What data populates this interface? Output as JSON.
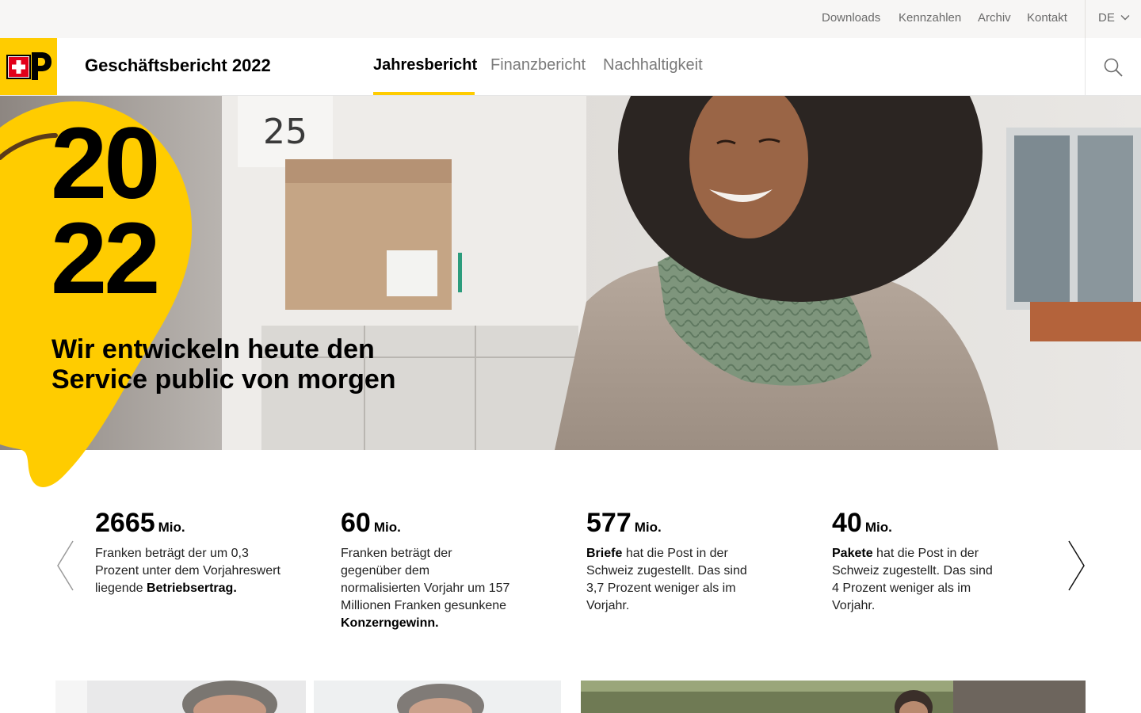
{
  "utility_nav": {
    "links": [
      "Downloads",
      "Kennzahlen",
      "Archiv",
      "Kontakt"
    ],
    "language": "DE"
  },
  "header": {
    "title": "Geschäftsbericht 2022",
    "nav": [
      {
        "label": "Jahresbericht",
        "active": true
      },
      {
        "label": "Finanzbericht",
        "active": false
      },
      {
        "label": "Nachhaltigkeit",
        "active": false
      }
    ]
  },
  "colors": {
    "brand_yellow": "#ffcc00",
    "logo_red": "#e2001a"
  },
  "icons": [
    "swiss-post-logo",
    "chevron-down-icon",
    "search-icon",
    "chevron-left-icon",
    "chevron-right-icon"
  ],
  "hero": {
    "year_top": "20",
    "year_bottom": "22",
    "headline_line1": "Wir entwickeln heute den",
    "headline_line2": "Service public von morgen",
    "house_number": "25"
  },
  "key_figures": [
    {
      "value": "2665",
      "unit": "Mio.",
      "text": "Franken beträgt der um 0,3 Prozent unter dem Vorjahreswert liegende",
      "bold": "Betriebsertrag.",
      "bold_first": false
    },
    {
      "value": "60",
      "unit": "Mio.",
      "text": "Franken beträgt der gegenüber dem normalisierten Vorjahr um 157 Millionen Franken gesunkene",
      "bold": "Konzerngewinn.",
      "bold_first": false
    },
    {
      "value": "577",
      "unit": "Mio.",
      "text": "hat die Post in der Schweiz zugestellt. Das sind 3,7 Prozent weniger als im Vorjahr.",
      "bold": "Briefe",
      "bold_first": true
    },
    {
      "value": "40",
      "unit": "Mio.",
      "text": "hat die Post in der Schweiz zugestellt. Das sind 4 Prozent weniger als im Vorjahr.",
      "bold": "Pakete",
      "bold_first": true
    }
  ]
}
